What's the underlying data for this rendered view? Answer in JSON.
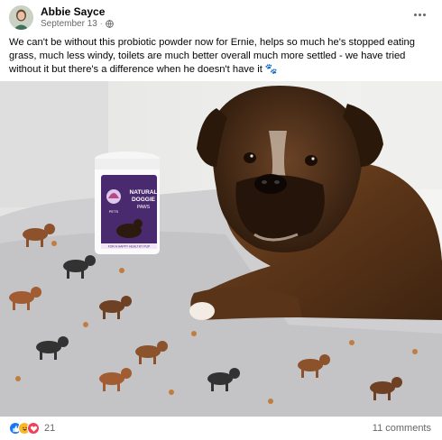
{
  "post": {
    "author": "Abbie Sayce",
    "date": "September 13",
    "separator": "·",
    "privacy_icon": "globe-icon",
    "text": "We can't be without this probiotic powder now for Ernie, helps so much he's stopped eating grass, much less windy, toilets are much better overall much more settled - we have tried without it but there's a difference when he doesn't have it 🐾"
  },
  "product": {
    "label_line1": "NATURAL",
    "label_line2": "DOGGIE",
    "label_line3": "PAWS",
    "brand": "PETS",
    "tagline": "FOR A HAPPY HEALTHY PUP"
  },
  "footer": {
    "reaction_icons": [
      "like-icon",
      "haha-icon",
      "love-icon"
    ],
    "reaction_count": "21",
    "comments": "11 comments"
  },
  "colors": {
    "like": "#1877f2",
    "haha": "#f7b928",
    "love": "#f33e58",
    "secondary_text": "#65676b",
    "label_purple": "#4a2a6e"
  }
}
